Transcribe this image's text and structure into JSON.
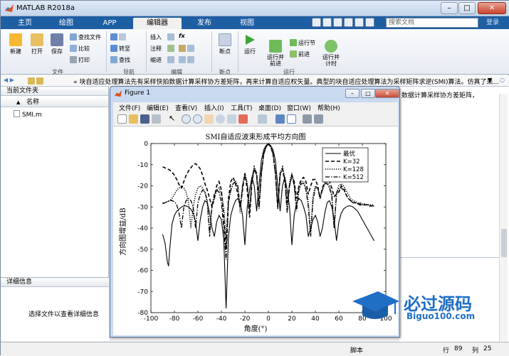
{
  "app": {
    "title": "MATLAB R2018a",
    "window_controls": {
      "minimize": "–",
      "maximize": "□",
      "close": "✕"
    }
  },
  "tabs": [
    "主页",
    "绘图",
    "APP",
    "编辑器",
    "发布",
    "视图"
  ],
  "active_tab": "编辑器",
  "search": {
    "placeholder": "搜索文档"
  },
  "login_label": "登录",
  "ribbon": {
    "file": {
      "new": "新建",
      "open": "打开",
      "save": "保存",
      "find_file": "查找文件",
      "compare": "比较",
      "print": "打印",
      "group": "文件"
    },
    "navigate": {
      "goto": "转至",
      "find": "查找",
      "group": "导航"
    },
    "edit": {
      "insert": "插入",
      "comment": "注释",
      "indent": "缩进",
      "fx": "fx",
      "group": "编辑"
    },
    "breakpoints": {
      "breakpoints": "断点",
      "group": "断点"
    },
    "run": {
      "run": "运行",
      "run_advance": "运行并\n前进",
      "run_section": "运行节",
      "advance": "前进",
      "run_time": "运行并\n计时",
      "group": "运行"
    }
  },
  "address_bar": {
    "text": "«  块自适应处理算法先有采样快拍数据计算采样协方差矩阵，再来计算自适应权矢量。典型的块自适应处理算法为采样矩阵求逆(SMI)算法。仿真了采..."
  },
  "current_folder": {
    "header": "当前文件夹",
    "column_name": "名称",
    "column_sort": "▲",
    "files": [
      {
        "name": "SMI.m"
      }
    ]
  },
  "details": {
    "header": "详细信息",
    "hint": "选择文件以查看详细信息"
  },
  "right_panel": {
    "text": "数据计算采样协方差矩阵，"
  },
  "status_bar": {
    "mode": "脚本",
    "line_label": "行",
    "line": "89",
    "col_label": "列",
    "col": "25"
  },
  "figure": {
    "title": "Figure 1",
    "menu": [
      "文件(F)",
      "编辑(E)",
      "查看(V)",
      "插入(I)",
      "工具(T)",
      "桌面(D)",
      "窗口(W)",
      "帮助(H)"
    ]
  },
  "watermark": {
    "text": "必过源码",
    "url": "Biguo100.com"
  },
  "chart_data": {
    "type": "line",
    "title": "SMI自适应波束形成平均方向图",
    "xlabel": "角度(°)",
    "ylabel": "方向图增益/dB",
    "xlim": [
      -100,
      100
    ],
    "ylim": [
      -80,
      0
    ],
    "xticks": [
      -100,
      -80,
      -60,
      -40,
      -20,
      0,
      20,
      40,
      60,
      80,
      100
    ],
    "yticks": [
      0,
      -10,
      -20,
      -30,
      -40,
      -50,
      -60,
      -70,
      -80
    ],
    "legend_position": "top-right",
    "series": [
      {
        "name": "最优",
        "style": "solid",
        "x": [
          -90,
          -88,
          -86,
          -85,
          -84,
          -82,
          -80,
          -78,
          -76,
          -74,
          -72,
          -70,
          -68,
          -66,
          -64,
          -62,
          -60,
          -58,
          -56,
          -54,
          -52,
          -50,
          -48,
          -46,
          -44,
          -42,
          -40,
          -38,
          -36,
          -34,
          -32,
          -30,
          -28,
          -26,
          -24,
          -22,
          -20,
          -18,
          -16,
          -14,
          -12,
          -10,
          -8,
          -6,
          -4,
          -2,
          0,
          2,
          4,
          6,
          8,
          10,
          12,
          14,
          16,
          18,
          20,
          22,
          24,
          26,
          28,
          30,
          32,
          34,
          36,
          38,
          40,
          42,
          44,
          46,
          48,
          50,
          52,
          54,
          56,
          58,
          60,
          62,
          64,
          66,
          68,
          70,
          72,
          74,
          76,
          78,
          80,
          82,
          84,
          86,
          88,
          90
        ],
        "y": [
          -43,
          -47,
          -56,
          -58,
          -50,
          -38,
          -34,
          -32,
          -31,
          -30,
          -29.5,
          -29.5,
          -30,
          -31,
          -33,
          -37,
          -46,
          -36,
          -30,
          -27,
          -28,
          -33,
          -40,
          -44,
          -37,
          -34,
          -36,
          -45,
          -78,
          -44,
          -34,
          -30,
          -27,
          -26,
          -28,
          -34,
          -48,
          -30,
          -22,
          -16,
          -20,
          -32,
          -20,
          -8,
          -3,
          -1,
          0,
          -1,
          -3,
          -8,
          -20,
          -32,
          -20,
          -16,
          -22,
          -30,
          -48,
          -34,
          -28,
          -26,
          -27,
          -30,
          -34,
          -44,
          -40,
          -36,
          -34,
          -37,
          -44,
          -40,
          -33,
          -28,
          -27,
          -30,
          -36,
          -46,
          -37,
          -33,
          -31,
          -30,
          -29.5,
          -29.5,
          -30,
          -31,
          -32,
          -34,
          -36,
          -38,
          -40,
          -42,
          -44,
          -46
        ]
      },
      {
        "name": "K=32",
        "style": "dashed",
        "x": [
          -90,
          -88,
          -86,
          -84,
          -82,
          -80,
          -78,
          -76,
          -74,
          -72,
          -70,
          -68,
          -66,
          -64,
          -62,
          -60,
          -58,
          -56,
          -54,
          -52,
          -50,
          -48,
          -46,
          -44,
          -42,
          -40,
          -38,
          -36,
          -34,
          -32,
          -30,
          -28,
          -26,
          -24,
          -22,
          -20,
          -18,
          -16,
          -14,
          -12,
          -10,
          -8,
          -6,
          -4,
          -2,
          0,
          2,
          4,
          6,
          8,
          10,
          12,
          14,
          16,
          18,
          20,
          22,
          24,
          26,
          28,
          30,
          32,
          34,
          36,
          38,
          40,
          42,
          44,
          46,
          48,
          50,
          52,
          54,
          56,
          58,
          60,
          62,
          64,
          66,
          68,
          70,
          72,
          74,
          76,
          78,
          80,
          82,
          84,
          86,
          88,
          90
        ],
        "y": [
          -11,
          -11.5,
          -12,
          -12.5,
          -13.5,
          -15,
          -17,
          -19.5,
          -21,
          -18,
          -15,
          -13,
          -11.5,
          -10,
          -9.5,
          -10.5,
          -12,
          -15,
          -19,
          -22,
          -26,
          -30,
          -26,
          -20,
          -18,
          -22,
          -35,
          -50,
          -26,
          -18,
          -16,
          -19,
          -24,
          -30,
          -22,
          -14,
          -22,
          -35,
          -18,
          -12,
          -14,
          -30,
          -14,
          -5,
          -1.5,
          0,
          -1.5,
          -5,
          -14,
          -30,
          -14,
          -12,
          -18,
          -28,
          -20,
          -15,
          -18,
          -26,
          -20,
          -17,
          -16,
          -18,
          -24,
          -20,
          -17,
          -17,
          -20,
          -26,
          -21,
          -18,
          -17,
          -18,
          -21,
          -25,
          -24,
          -23,
          -20,
          -21,
          -24,
          -26,
          -27,
          -28,
          -28,
          -28.5,
          -29,
          -29,
          -29,
          -29,
          -29.5,
          -29.5,
          -29.5
        ]
      },
      {
        "name": "K=128",
        "style": "dotted",
        "x": [
          -90,
          -88,
          -86,
          -84,
          -82,
          -80,
          -78,
          -76,
          -74,
          -72,
          -70,
          -68,
          -66,
          -64,
          -62,
          -60,
          -58,
          -56,
          -54,
          -52,
          -50,
          -48,
          -46,
          -44,
          -42,
          -40,
          -38,
          -36,
          -34,
          -32,
          -30,
          -28,
          -26,
          -24,
          -22,
          -20,
          -18,
          -16,
          -14,
          -12,
          -10,
          -8,
          -6,
          -4,
          -2,
          0,
          2,
          4,
          6,
          8,
          10,
          12,
          14,
          16,
          18,
          20,
          22,
          24,
          26,
          28,
          30,
          32,
          34,
          36,
          38,
          40,
          42,
          44,
          46,
          48,
          50,
          52,
          54,
          56,
          58,
          60,
          62,
          64,
          66,
          68,
          70,
          72,
          74,
          76,
          78,
          80,
          82,
          84,
          86,
          88,
          90
        ],
        "y": [
          -28,
          -28,
          -27.5,
          -27,
          -26,
          -24,
          -22,
          -21,
          -20,
          -21,
          -23,
          -28,
          -40,
          -30,
          -24,
          -21,
          -20,
          -21,
          -23,
          -28,
          -42,
          -30,
          -26,
          -22,
          -21,
          -24,
          -30,
          -45,
          -27,
          -22,
          -19,
          -18,
          -21,
          -33,
          -20,
          -14,
          -19,
          -32,
          -16,
          -11,
          -14,
          -30,
          -14,
          -5,
          -1.5,
          0,
          -1.5,
          -5,
          -14,
          -30,
          -14,
          -11,
          -16,
          -30,
          -19,
          -14,
          -19,
          -30,
          -21,
          -18,
          -18,
          -21,
          -28,
          -42,
          -25,
          -20,
          -21,
          -26,
          -22,
          -19,
          -18,
          -20,
          -24,
          -40,
          -23,
          -20,
          -19,
          -20,
          -22,
          -24,
          -26,
          -27,
          -27.5,
          -28,
          -28,
          -28.5,
          -28.5,
          -29,
          -29,
          -29,
          -29
        ]
      },
      {
        "name": "K=512",
        "style": "dashdot",
        "x": [
          -90,
          -88,
          -86,
          -84,
          -82,
          -80,
          -78,
          -76,
          -74,
          -72,
          -70,
          -68,
          -66,
          -64,
          -62,
          -60,
          -58,
          -56,
          -54,
          -52,
          -50,
          -48,
          -46,
          -44,
          -42,
          -40,
          -38,
          -36,
          -34,
          -32,
          -30,
          -28,
          -26,
          -24,
          -22,
          -20,
          -18,
          -16,
          -14,
          -12,
          -10,
          -8,
          -6,
          -4,
          -2,
          0,
          2,
          4,
          6,
          8,
          10,
          12,
          14,
          16,
          18,
          20,
          22,
          24,
          26,
          28,
          30,
          32,
          34,
          36,
          38,
          40,
          42,
          44,
          46,
          48,
          50,
          52,
          54,
          56,
          58,
          60,
          62,
          64,
          66,
          68,
          70,
          72,
          74,
          76,
          78,
          80,
          82,
          84,
          86,
          88,
          90
        ],
        "y": [
          -28.5,
          -28,
          -27.5,
          -27,
          -27,
          -27.5,
          -29,
          -33,
          -40,
          -30,
          -27,
          -26,
          -27,
          -30,
          -40,
          -28,
          -24,
          -22,
          -23,
          -27,
          -44,
          -29,
          -24,
          -22,
          -23,
          -28,
          -40,
          -55,
          -28,
          -22,
          -19,
          -18,
          -20,
          -30,
          -20,
          -15,
          -19,
          -33,
          -17,
          -12,
          -15,
          -31,
          -14,
          -5,
          -1.5,
          0,
          -1.5,
          -5,
          -14,
          -31,
          -15,
          -12,
          -17,
          -33,
          -20,
          -15,
          -20,
          -32,
          -22,
          -19,
          -19,
          -22,
          -30,
          -44,
          -27,
          -21,
          -21,
          -25,
          -22,
          -19,
          -19,
          -21,
          -25,
          -40,
          -24,
          -21,
          -21,
          -22,
          -24,
          -26,
          -27,
          -28,
          -28,
          -28.5,
          -28.5,
          -29,
          -29,
          -29,
          -29,
          -29.5,
          -29.5
        ]
      }
    ]
  }
}
